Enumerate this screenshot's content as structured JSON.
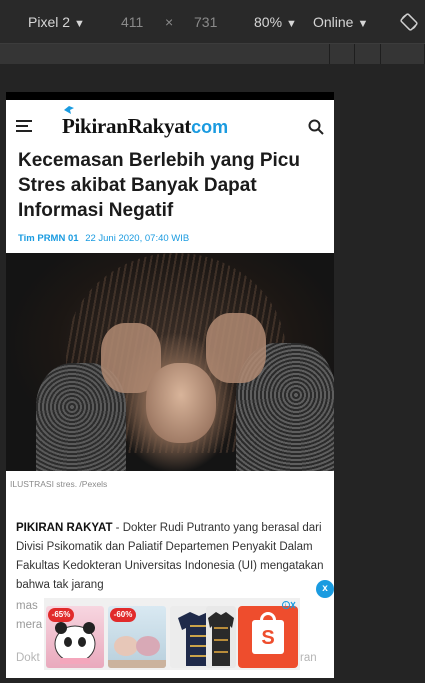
{
  "devtools": {
    "device": "Pixel 2",
    "width": "411",
    "times": "×",
    "height": "731",
    "zoom": "80%",
    "network": "Online",
    "caret": "▼"
  },
  "site": {
    "logo_main": "PikiranRakyat",
    "logo_suffix": "com"
  },
  "article": {
    "headline": "Kecemasan Berlebih yang Picu Stres akibat Banyak Dapat Informasi Negatif",
    "author": "Tim PRMN 01",
    "date": "22 Juni 2020, 07:40 WIB",
    "photo_caption": "ILUSTRASI stres. /Pexels",
    "lead_source": "PIKIRAN RAKYAT",
    "lead_text": " - Dokter Rudi Putranto yang berasal dari Divisi Psikomatik dan Paliatif Departemen Penyakit Dalam Fakultas Kedokteran Universitas Indonesia (UI) mengatakan bahwa tak jarang",
    "line_partial_1": "mas",
    "line_partial_2": "mera",
    "line_partial_3": "Dokt",
    "line_partial_4": "ran"
  },
  "ad": {
    "close_label": "x",
    "badge_1": "-65%",
    "badge_2": "-60%",
    "shop_letter": "S"
  },
  "colors": {
    "accent": "#1a9be0",
    "shopee": "#ee4d2d",
    "badge": "#e12b2b"
  }
}
